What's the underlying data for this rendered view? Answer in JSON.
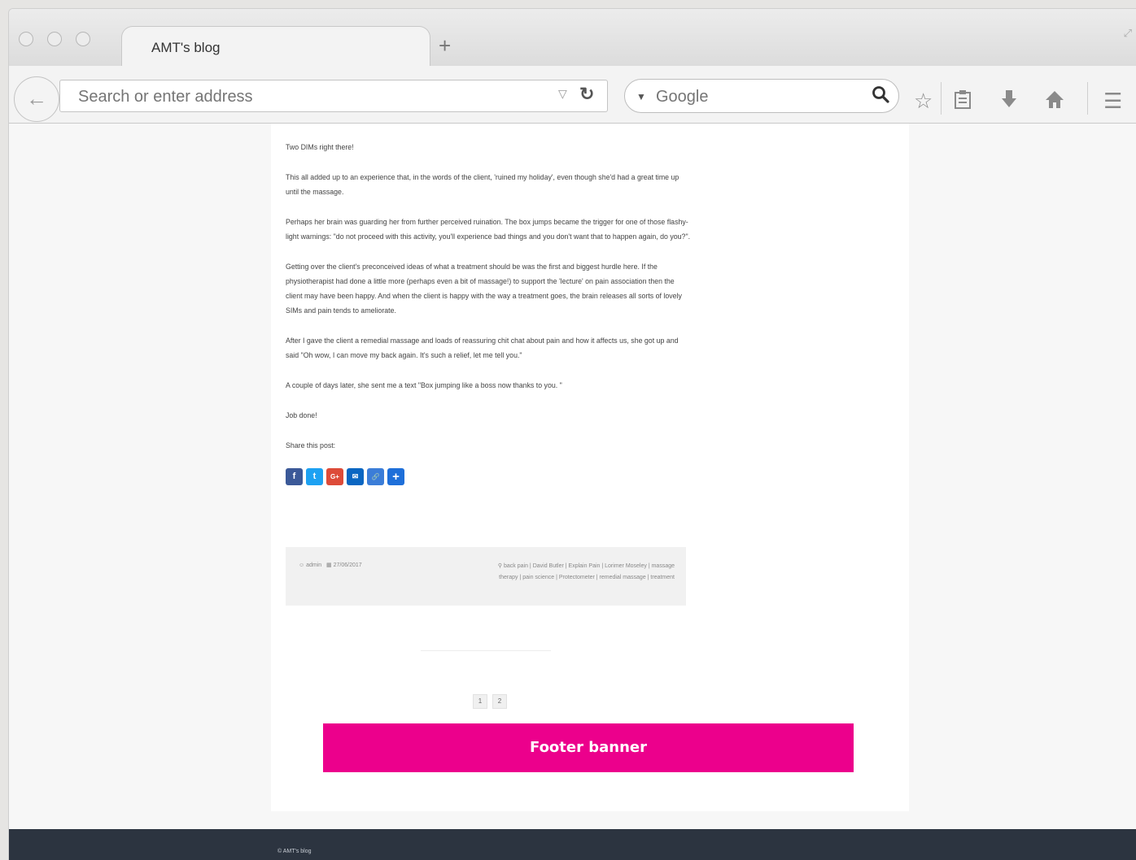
{
  "browser": {
    "tab_title": "AMT's blog",
    "new_tab": "+",
    "address_placeholder": "Search or enter address",
    "search_engine": "Google"
  },
  "post": {
    "paragraphs": [
      "Two DIMs right there!",
      "This all added up to an experience that, in the words of the client, 'ruined my holiday', even though she'd had a great time up until the massage.",
      "Perhaps her brain was guarding her from further perceived ruination. The box jumps became the trigger for one of those flashy-light warnings: \"do not proceed with this activity, you'll experience bad things and you don't want that to happen again, do you?\".",
      "Getting over the client's preconceived ideas of what a treatment should be was the first and biggest hurdle here. If the physiotherapist had done a little more (perhaps even a bit of massage!) to support the 'lecture' on pain association then the client may have been happy. And when the client is happy with the way a treatment goes, the brain releases all sorts of lovely SIMs and pain tends to ameliorate.",
      "After I gave the client a remedial massage and loads of reassuring chit chat about pain and how it affects us, she got up and said \"Oh wow, I can move my back again. It's such a relief, let me tell you.\"",
      "A couple of days later, she sent me a text \"Box jumping like a boss now thanks to you. \"",
      "Job done!"
    ],
    "share_label": "Share this post:",
    "share_buttons": [
      "f",
      "t",
      "G+",
      "✉",
      "🔗",
      "+"
    ]
  },
  "meta": {
    "author": "admin",
    "date": "27/06/2017",
    "tags": "back pain | David Butler | Explain Pain | Lorimer Moseley | massage therapy | pain science | Protectometer | remedial massage | treatment"
  },
  "pagination": [
    "1",
    "2"
  ],
  "banner": "Footer banner",
  "footer": "© AMT's blog",
  "colors": {
    "banner": "#ec008c",
    "footer_bg": "#2c3440",
    "share": [
      "#3b5998",
      "#1da1f2",
      "#dd4b39",
      "#0a66c2",
      "#3b7dd8",
      "#1e6fd9"
    ]
  }
}
